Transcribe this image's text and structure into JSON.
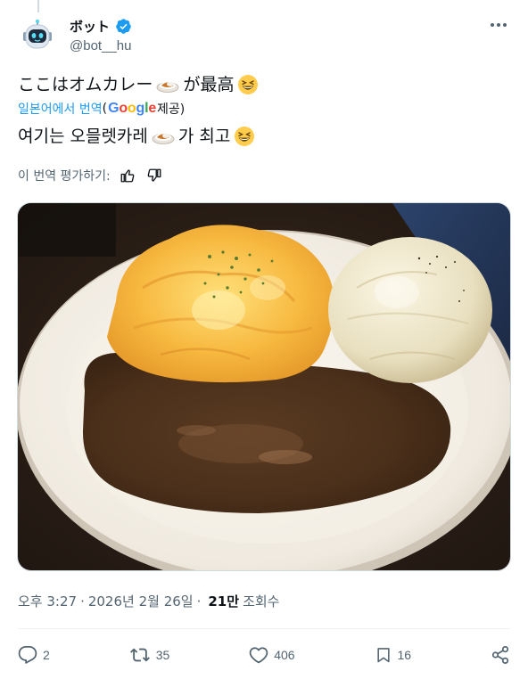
{
  "user": {
    "display_name": "ボット",
    "handle": "@bot__hu",
    "verified": true,
    "avatar_icon": "robot-icon"
  },
  "tweet": {
    "text_before_emoji": "ここはオムカレー",
    "text_after_emoji": "が最高",
    "emoji_1": "curry-rice-emoji",
    "emoji_2": "grinning-squinting-face-emoji"
  },
  "translation": {
    "link_text": "일본어에서 번역",
    "provider_prefix": "(",
    "provider_name": "Google",
    "provider_suffix": " 제공)",
    "text_before_emoji": "여기는 오믈렛카레",
    "text_after_emoji": "가 최고",
    "rate_label": "이 번역 평가하기:"
  },
  "meta": {
    "time": "오후 3:27",
    "separator": "·",
    "date": "2026년 2월 26일",
    "views_count": "21만",
    "views_label": "조회수"
  },
  "actions": {
    "replies": "2",
    "reposts": "35",
    "likes": "406",
    "bookmarks": "16"
  },
  "colors": {
    "accent": "#1d9bf0",
    "text": "#0f1419",
    "secondary": "#536471",
    "border": "#cfd9de"
  }
}
